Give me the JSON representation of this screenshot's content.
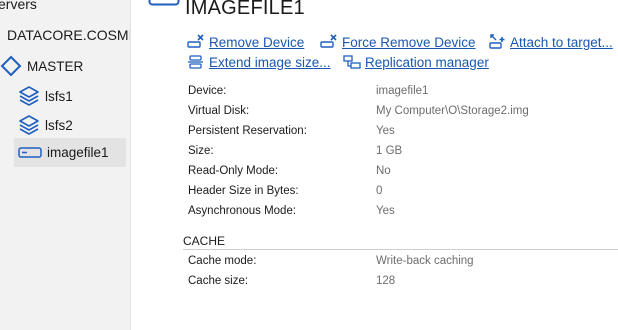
{
  "sidebar": {
    "header": "ervers",
    "server": "DATACORE.COSMI",
    "group": "MASTER",
    "items": [
      {
        "label": "lsfs1"
      },
      {
        "label": "lsfs2"
      },
      {
        "label": "imagefile1"
      }
    ]
  },
  "header": {
    "title": "IMAGEFILE1"
  },
  "actions": {
    "remove": "Remove Device",
    "force_remove": "Force Remove Device",
    "attach": "Attach to target...",
    "extend": "Extend image size...",
    "replication": "Replication manager"
  },
  "properties": [
    {
      "label": "Device:",
      "value": "imagefile1"
    },
    {
      "label": "Virtual Disk:",
      "value": "My Computer\\O\\Storage2.img"
    },
    {
      "label": "Persistent Reservation:",
      "value": "Yes"
    },
    {
      "label": "Size:",
      "value": "1 GB"
    },
    {
      "label": "Read-Only Mode:",
      "value": "No"
    },
    {
      "label": "Header Size in Bytes:",
      "value": "0"
    },
    {
      "label": "Asynchronous Mode:",
      "value": "Yes"
    }
  ],
  "cache": {
    "title": "CACHE",
    "rows": [
      {
        "label": "Cache mode:",
        "value": "Write-back caching"
      },
      {
        "label": "Cache size:",
        "value": "128"
      }
    ]
  },
  "colors": {
    "link": "#1a57b0",
    "icon": "#1f5fbf",
    "selected": "#e3e3e3"
  }
}
